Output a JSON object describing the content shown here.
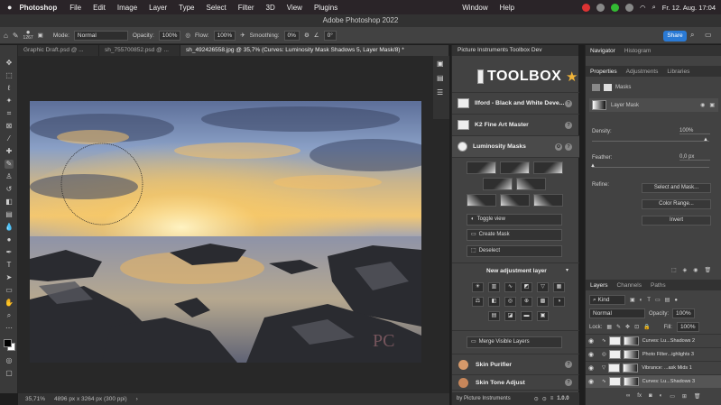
{
  "menubar": {
    "apple": "",
    "app": "Photoshop",
    "items": [
      "File",
      "Edit",
      "Image",
      "Layer",
      "Type",
      "Select",
      "Filter",
      "3D",
      "View",
      "Plugins",
      "Window",
      "Help"
    ],
    "clock": "Fr. 12. Aug.  17:04"
  },
  "window_title": "Adobe Photoshop 2022",
  "options": {
    "mode_label": "Mode:",
    "mode_value": "Normal",
    "opacity_label": "Opacity:",
    "opacity_value": "100%",
    "flow_label": "Flow:",
    "flow_value": "100%",
    "smoothing_label": "Smoothing:",
    "smoothing_value": "0%",
    "angle_value": "0°",
    "brush_size": "1267",
    "share": "Share"
  },
  "tabs": [
    "Graphic Draft.psd @ ...",
    "sh_755700852.psd @ ...",
    "sh_492426558.jpg @ 35,7% (Curves: Luminosity Mask Shadows 5, Layer Mask/8) *"
  ],
  "status": {
    "zoom": "35,71%",
    "doc": "4896 px x 3264 px (300 ppi)"
  },
  "plugin": {
    "panel_title": "Picture Instruments Toolbox Dev",
    "logo": "TOOLBOX",
    "rows": [
      "Ilford - Black and White Deve...",
      "K2 Fine Art Master",
      "Luminosity Masks"
    ],
    "buttons": [
      "Toggle view",
      "Create Mask",
      "Deselect"
    ],
    "new_adj": "New adjustment layer",
    "merge": "Merge Visible Layers",
    "rows2": [
      "Skin Purifier",
      "Skin Tone Adjust"
    ],
    "footer": "by Picture Instruments",
    "version": "1.0.0"
  },
  "navigator": {
    "tabs": [
      "Navigator",
      "Histogram"
    ]
  },
  "properties": {
    "tabs": [
      "Properties",
      "Adjustments",
      "Libraries"
    ],
    "masks_label": "Masks",
    "layer_mask": "Layer Mask",
    "density_label": "Density:",
    "density_value": "100%",
    "feather_label": "Feather:",
    "feather_value": "0,0 px",
    "refine_label": "Refine:",
    "btn_select": "Select and Mask...",
    "btn_color": "Color Range...",
    "btn_invert": "Invert"
  },
  "layers": {
    "tabs": [
      "Layers",
      "Channels",
      "Paths"
    ],
    "kind": "Kind",
    "blend": "Normal",
    "opacity_label": "Opacity:",
    "opacity_value": "100%",
    "lock_label": "Lock:",
    "fill_label": "Fill:",
    "fill_value": "100%",
    "items": [
      "Curves: Lu...Shadows 2",
      "Photo Filter...ighlights 3",
      "Vibrance: ...ask Mids 1",
      "Curves: Lu...Shadows 3"
    ]
  },
  "watermark": "PC"
}
